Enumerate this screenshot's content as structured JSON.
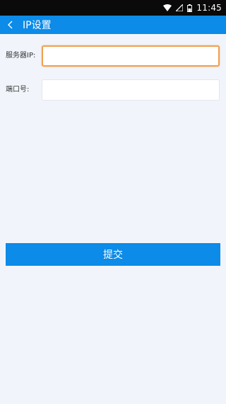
{
  "status_bar": {
    "time": "11:45",
    "icons": [
      "wifi-icon",
      "signal-icon",
      "battery-icon"
    ]
  },
  "app_bar": {
    "back_icon": "chevron-left-icon",
    "title": "IP设置",
    "background": "#0c8be8"
  },
  "form": {
    "server_ip": {
      "label": "服务器IP:",
      "value": "",
      "placeholder": ""
    },
    "port": {
      "label": "端口号:",
      "value": "",
      "placeholder": ""
    }
  },
  "submit": {
    "label": "提交"
  },
  "colors": {
    "accent": "#0c8be8",
    "focus_border": "#f0a050",
    "page_background": "#f1f5fb"
  }
}
